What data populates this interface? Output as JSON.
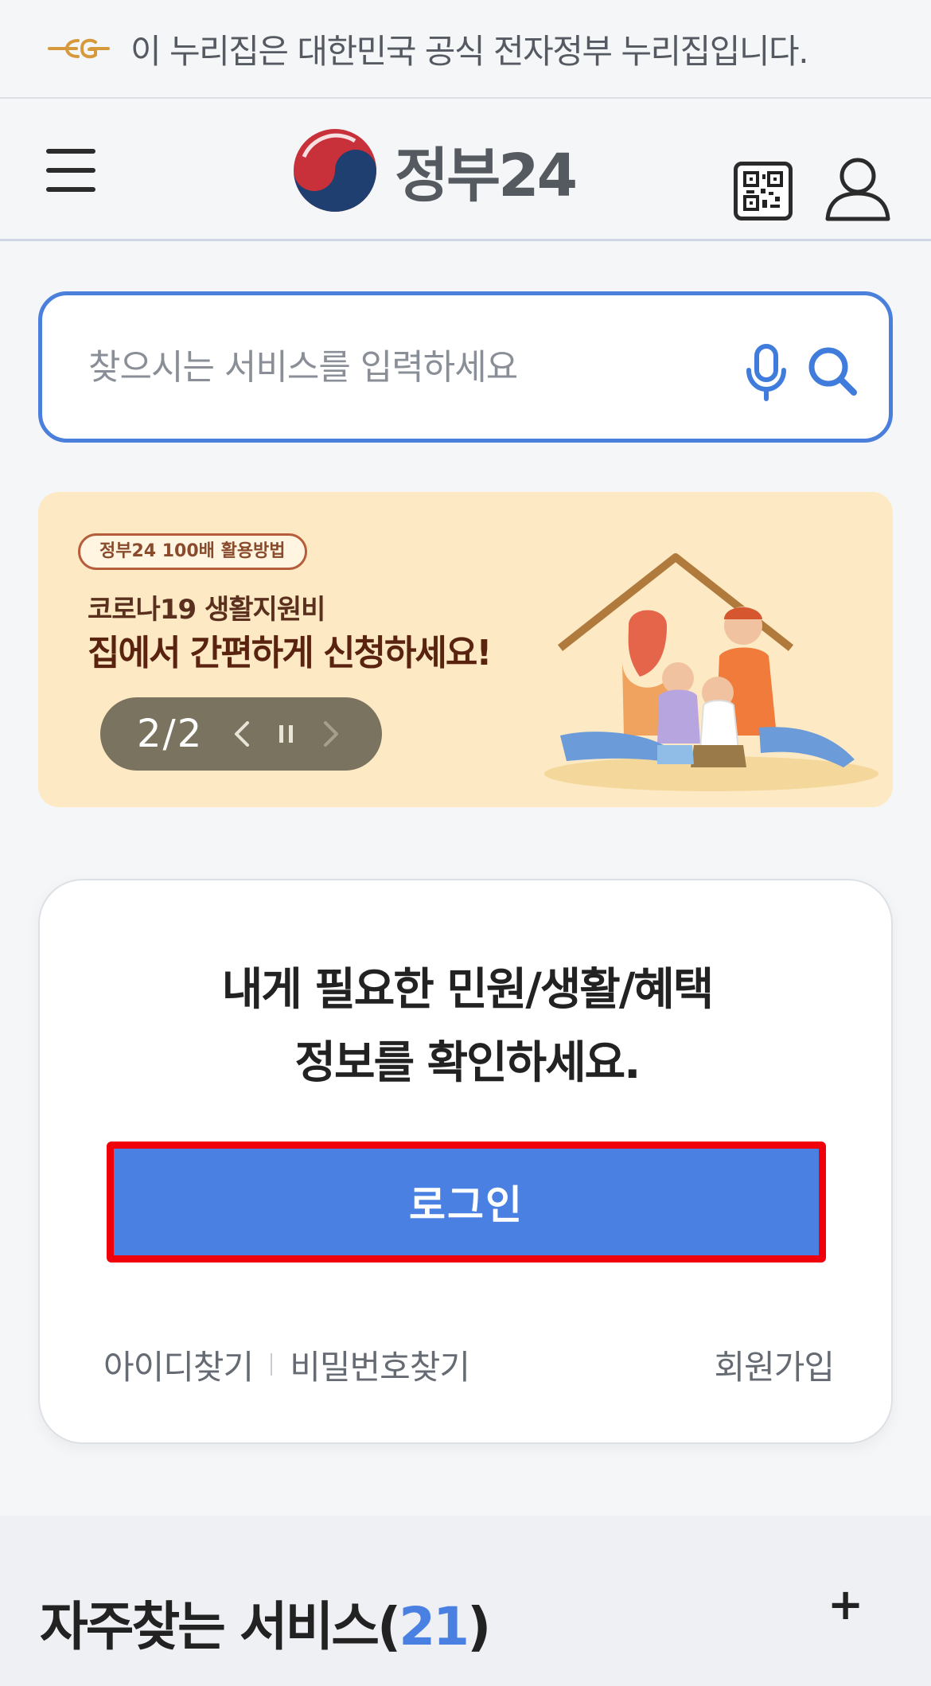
{
  "gov_banner": {
    "text": "이 누리집은 대한민국 공식 전자정부 누리집입니다.",
    "icon": "eg-emblem-icon",
    "accent": "#d69a3c"
  },
  "header": {
    "logo_text": "정부24",
    "menu_icon": "hamburger-menu-icon",
    "qr_icon": "qr-code-icon",
    "user_icon": "user-icon"
  },
  "search": {
    "placeholder": "찾으시는 서비스를 입력하세요",
    "value": "",
    "border_color": "#4b7fdc"
  },
  "banner": {
    "tag": "정부24 100배 활용방법",
    "subtitle": "코로나19 생활지원비",
    "headline": "집에서 간편하게 신청하세요!",
    "slide_current": "2",
    "slide_total": "2",
    "slide_label": "2/2",
    "background": "#fde9c3"
  },
  "login_card": {
    "message_line1": "내게 필요한 민원/생활/혜택",
    "message_line2": "정보를 확인하세요.",
    "login_label": "로그인",
    "find_id": "아이디찾기",
    "find_password": "비밀번호찾기",
    "signup": "회원가입",
    "button_color": "#4a80e2"
  },
  "frequent_services": {
    "title": "자주찾는 서비스",
    "open_paren": "(",
    "count": "21",
    "close_paren": ")",
    "expand_label": "+"
  }
}
